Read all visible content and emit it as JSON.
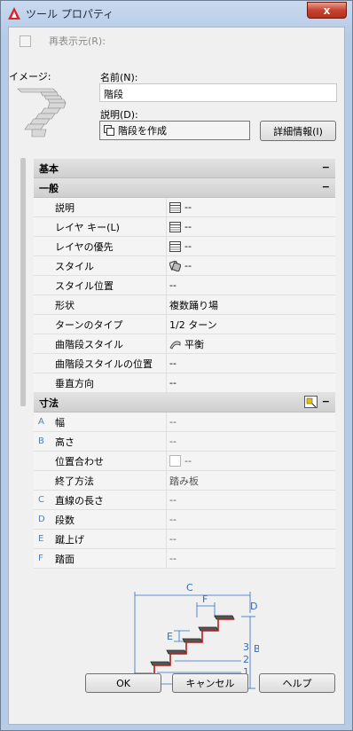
{
  "window": {
    "title": "ツール プロパティ",
    "close_label": "x"
  },
  "top": {
    "redisplay_label": "再表示元(R):",
    "image_label": "イメージ:",
    "name_label": "名前(N):",
    "name_value": "階段",
    "desc_label": "説明(D):",
    "desc_value": "階段を作成",
    "details_button": "詳細情報(I)"
  },
  "sections": {
    "basic": "基本",
    "general": "一般",
    "dimensions": "寸法"
  },
  "general_rows": [
    {
      "name": "説明",
      "value": "--",
      "icon": "table-icon"
    },
    {
      "name": "レイヤ キー(L)",
      "value": "--",
      "icon": "table-icon"
    },
    {
      "name": "レイヤの優先",
      "value": "--",
      "icon": "table-icon"
    },
    {
      "name": "スタイル",
      "value": "--",
      "icon": "style-icon"
    },
    {
      "name": "スタイル位置",
      "value": "--",
      "icon": ""
    },
    {
      "name": "形状",
      "value": "複数踊り場",
      "icon": ""
    },
    {
      "name": "ターンのタイプ",
      "value": "1/2 ターン",
      "icon": ""
    },
    {
      "name": "曲階段スタイル",
      "value": "平衡",
      "icon": "curved-stair-icon"
    },
    {
      "name": "曲階段スタイルの位置",
      "value": "--",
      "icon": ""
    },
    {
      "name": "垂直方向",
      "value": "--",
      "icon": ""
    }
  ],
  "dim_rows": [
    {
      "letter": "A",
      "name": "幅",
      "value": "--"
    },
    {
      "letter": "B",
      "name": "高さ",
      "value": "--"
    },
    {
      "letter": "",
      "name": "位置合わせ",
      "value": "--"
    },
    {
      "letter": "",
      "name": "終了方法",
      "value": "踏み板"
    },
    {
      "letter": "C",
      "name": "直線の長さ",
      "value": "--"
    },
    {
      "letter": "D",
      "name": "段数",
      "value": "--"
    },
    {
      "letter": "E",
      "name": "蹴上げ",
      "value": "--"
    },
    {
      "letter": "F",
      "name": "踏面",
      "value": "--"
    }
  ],
  "diagram_labels": {
    "c": "C",
    "d": "D",
    "e": "E",
    "f": "F",
    "b": "B",
    "a": "A",
    "n1": "1",
    "n2": "2",
    "n3": "3"
  },
  "buttons": {
    "ok": "OK",
    "cancel": "キャンセル",
    "help": "ヘルプ"
  }
}
